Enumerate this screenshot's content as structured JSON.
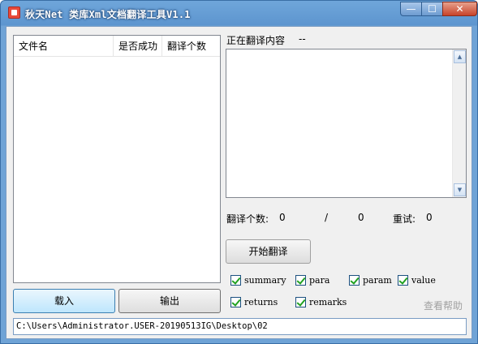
{
  "window": {
    "title": "秋天Net  类库Xml文档翻译工具V1.1",
    "min_label": "—",
    "max_label": "☐",
    "close_label": "✕"
  },
  "file_list": {
    "columns": [
      "文件名",
      "是否成功",
      "翻译个数"
    ],
    "rows": []
  },
  "current": {
    "label": "正在翻译内容",
    "value": "--"
  },
  "content_box": {
    "text": ""
  },
  "stats": {
    "count_label": "翻译个数:",
    "done": "0",
    "separator": "/",
    "total": "0",
    "retry_label": "重试:",
    "retry": "0"
  },
  "buttons": {
    "start": "开始翻译",
    "load": "载入",
    "export": "输出"
  },
  "options": [
    {
      "label": "summary",
      "checked": true
    },
    {
      "label": "para",
      "checked": true
    },
    {
      "label": "param",
      "checked": true
    },
    {
      "label": "value",
      "checked": true
    },
    {
      "label": "returns",
      "checked": true
    },
    {
      "label": "remarks",
      "checked": true
    }
  ],
  "help_link": "查看帮助",
  "path": "C:\\Users\\Administrator.USER-20190513IG\\Desktop\\02",
  "colors": {
    "titlebar": "#5d95cf",
    "check": "#21a121",
    "help": "#a0a0a0"
  }
}
